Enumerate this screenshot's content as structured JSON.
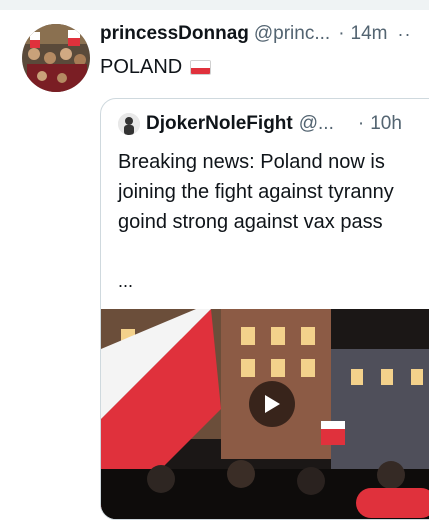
{
  "tweet": {
    "author_name": "princessDonnag",
    "author_handle": "@princ...",
    "separator": "·",
    "time": "14m",
    "more_icon": "more-icon",
    "text": "POLAND",
    "flag_icon": "poland-flag-icon",
    "flag_colors": [
      "#ffffff",
      "#e0313c"
    ]
  },
  "quoted_tweet": {
    "author_name": "DjokerNoleFight",
    "author_handle": "@...",
    "separator": "·",
    "time": "10h",
    "text": "Breaking news: Poland now is joining the fight against tyranny goind strong against vax pass",
    "ellipsis": "...",
    "media": {
      "type": "video",
      "play_icon": "play-icon"
    }
  },
  "colors": {
    "text": "#0f1419",
    "secondary": "#536471",
    "border": "#cfd9de",
    "accent_red": "#e0313c"
  }
}
